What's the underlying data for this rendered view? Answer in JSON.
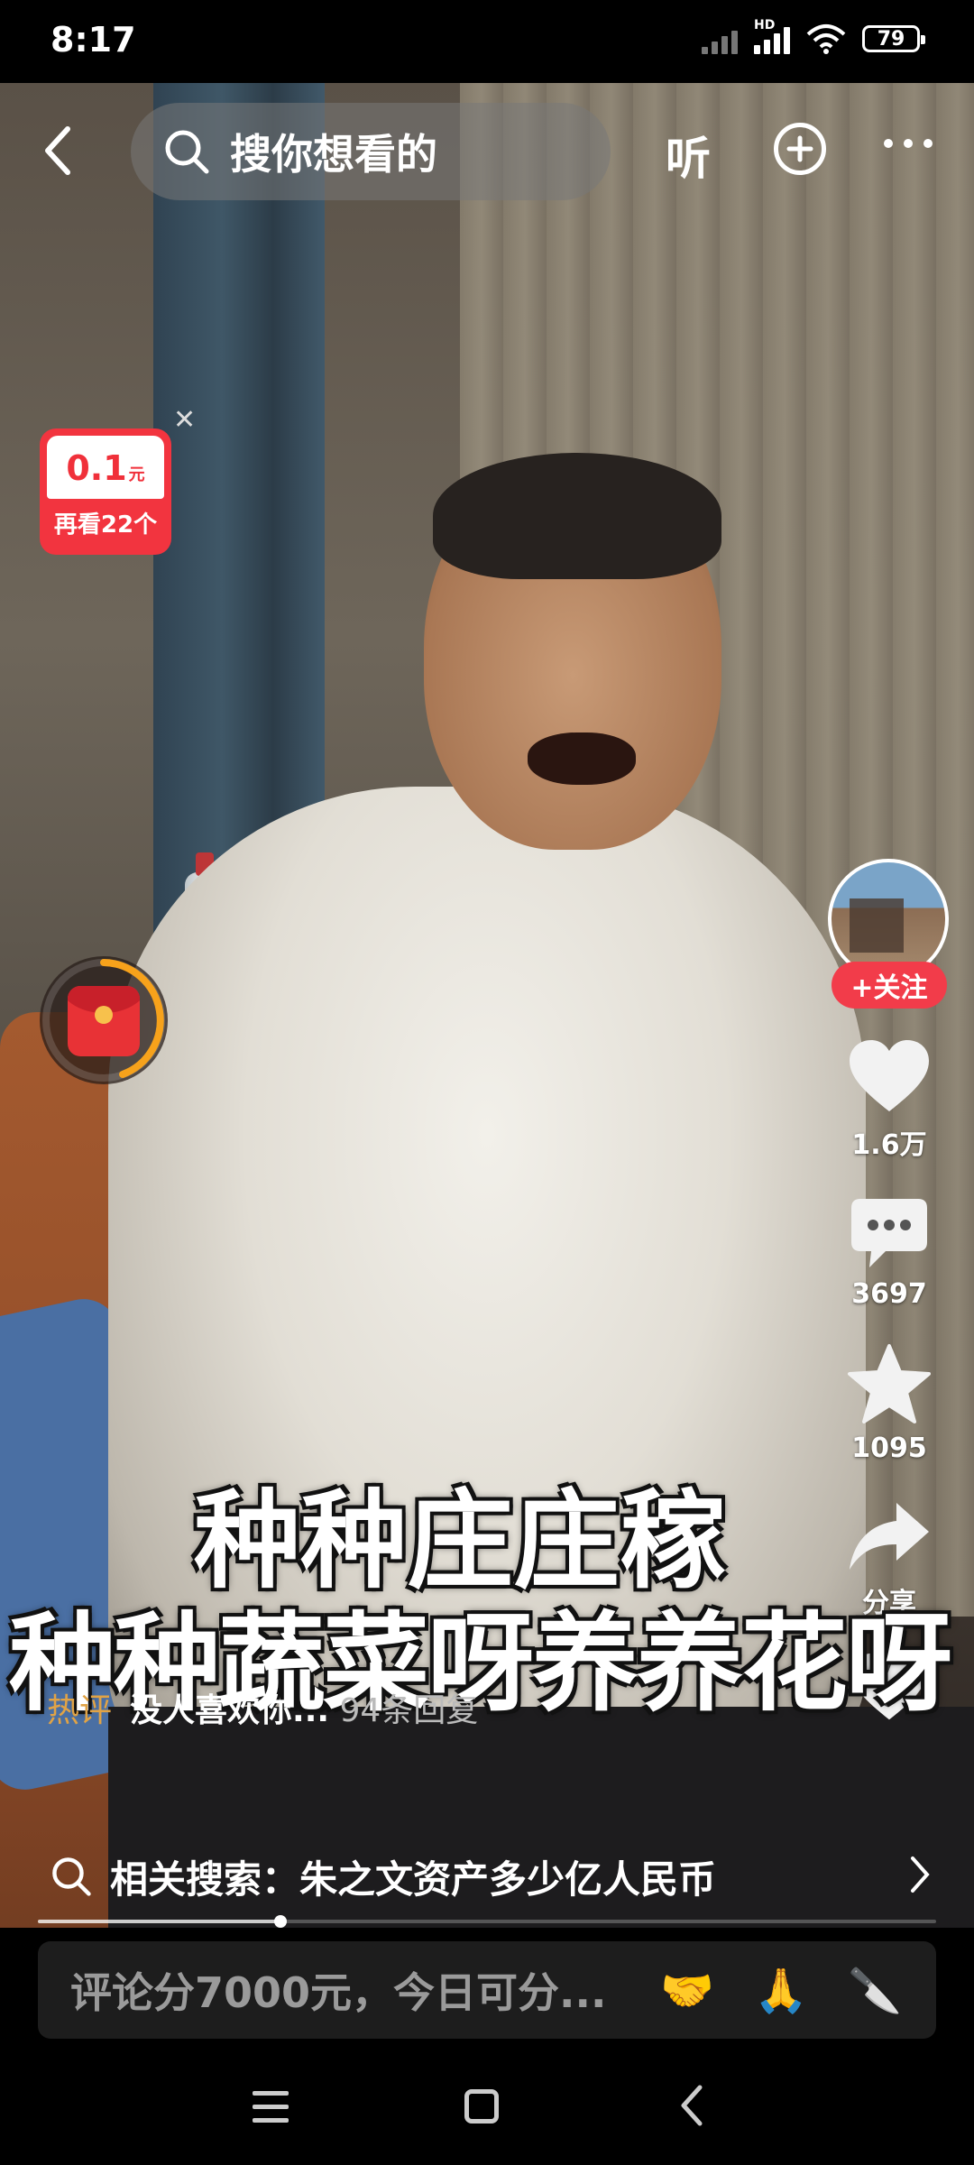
{
  "status_bar": {
    "time": "8:17",
    "network_badge": "HD",
    "battery": "79"
  },
  "top_bar": {
    "search_placeholder": "搜你想看的",
    "listen_label": "听"
  },
  "reward_widget": {
    "amount": "0.1",
    "unit": "元",
    "caption": "再看22个"
  },
  "actions": {
    "follow_label": "+关注",
    "likes": "1.6万",
    "comments": "3697",
    "favorites": "1095",
    "share": "分享"
  },
  "subtitles": {
    "line1": "种种庄庄稼",
    "line2": "种种蔬菜呀养养花呀"
  },
  "hot_comment": {
    "tag": "热评",
    "text": "没人喜欢你...",
    "replies": "94条回复"
  },
  "related_search": {
    "label": "相关搜索：朱之文资产多少亿人民币"
  },
  "progress": {
    "fraction": 0.27
  },
  "comment_bar": {
    "placeholder": "评论分7000元，今日可分...",
    "emojis": [
      "🤝",
      "🙏",
      "🔪"
    ]
  },
  "colors": {
    "accent_red": "#f23c4a",
    "hot_tag": "#e0a346",
    "timer_ring": "#f7a21b"
  }
}
